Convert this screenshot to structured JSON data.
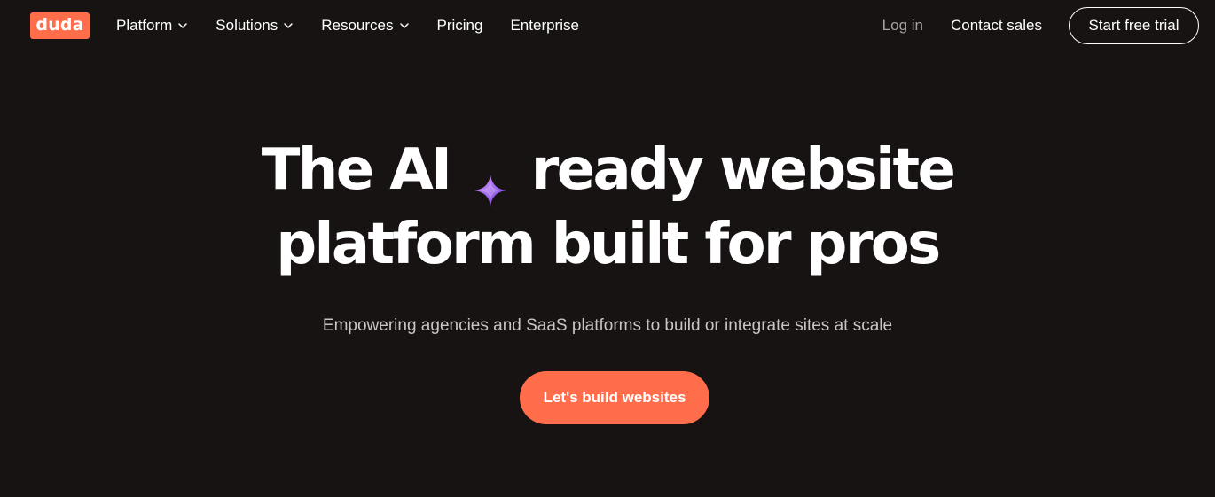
{
  "brand": {
    "logo_text": "duda",
    "accent_color": "#ff6d4b",
    "background_color": "#181313"
  },
  "nav": {
    "items": [
      {
        "label": "Platform",
        "has_dropdown": true,
        "icon": "chevron-down-icon"
      },
      {
        "label": "Solutions",
        "has_dropdown": true,
        "icon": "chevron-down-icon"
      },
      {
        "label": "Resources",
        "has_dropdown": true,
        "icon": "chevron-down-icon"
      },
      {
        "label": "Pricing",
        "has_dropdown": false
      },
      {
        "label": "Enterprise",
        "has_dropdown": false
      }
    ],
    "login_label": "Log in",
    "contact_label": "Contact sales",
    "trial_label": "Start free trial"
  },
  "hero": {
    "headline_part1": "The AI",
    "headline_icon": "sparkle-icon",
    "headline_part2": "ready website",
    "headline_line2": "platform built for pros",
    "subheadline": "Empowering agencies and SaaS platforms to build or integrate sites at scale",
    "cta_label": "Let's build websites"
  }
}
